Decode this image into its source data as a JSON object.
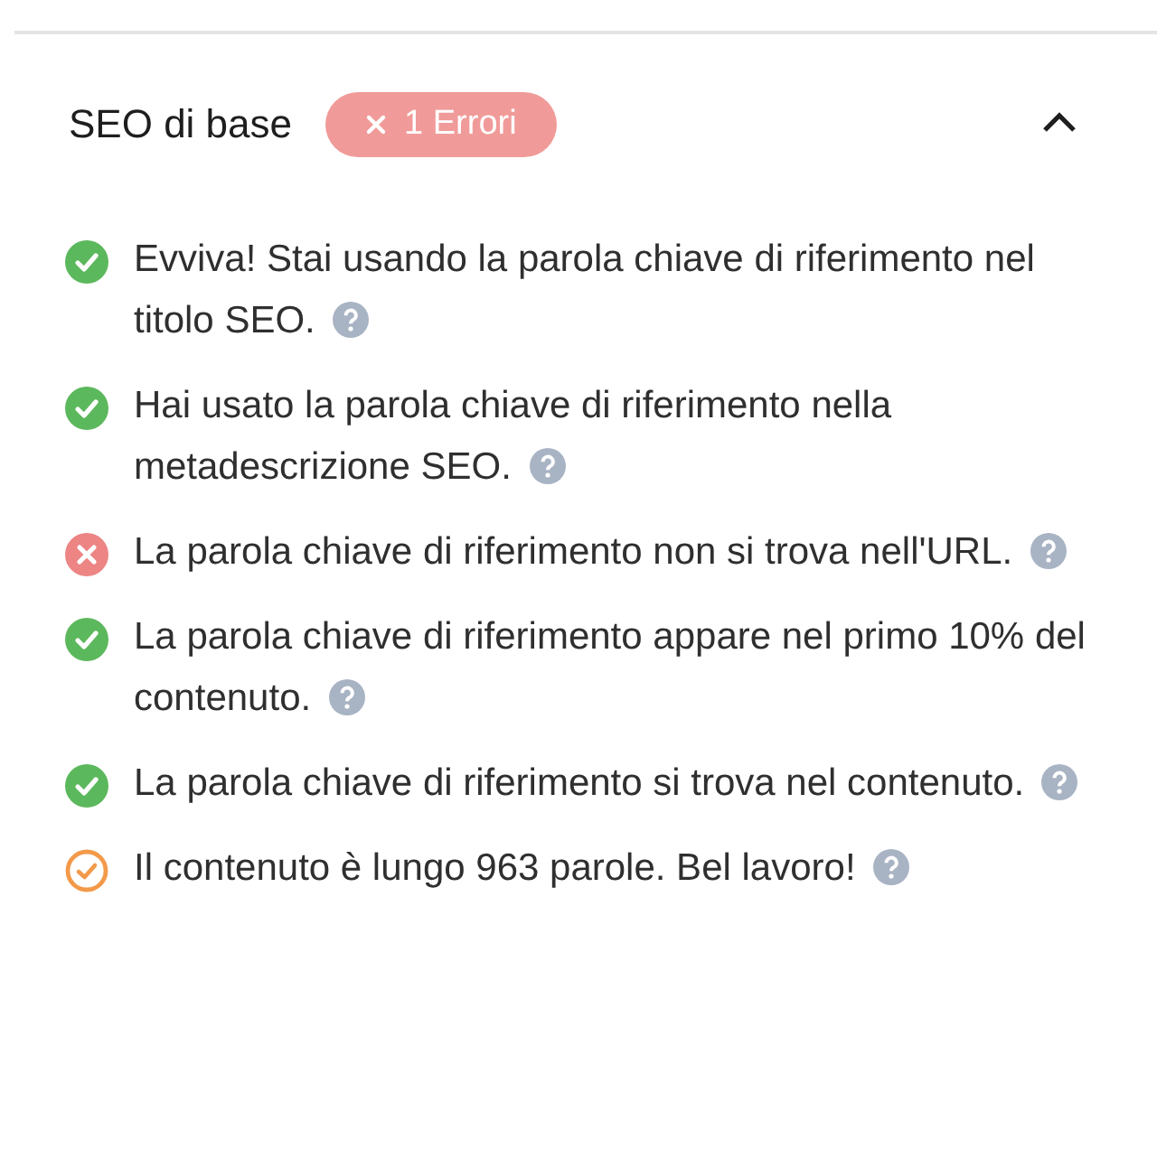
{
  "panel": {
    "title": "SEO di base",
    "badge": "1 Errori",
    "expanded": true
  },
  "checks": [
    {
      "kind": "pass",
      "text": "Evviva! Stai usando la parola chiave di riferimento nel titolo SEO."
    },
    {
      "kind": "pass",
      "text": "Hai usato la parola chiave di riferimento nella metadescrizione SEO."
    },
    {
      "kind": "fail",
      "text": "La parola chiave di riferimento non si trova nell'URL."
    },
    {
      "kind": "pass",
      "text": "La parola chiave di riferimento appare nel primo 10% del contenuto."
    },
    {
      "kind": "pass",
      "text": "La parola chiave di riferimento si trova nel contenuto."
    },
    {
      "kind": "warn",
      "text": "Il contenuto è lungo 963 parole. Bel lavoro!"
    }
  ]
}
